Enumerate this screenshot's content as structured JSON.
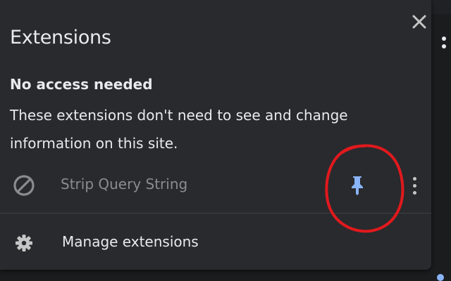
{
  "panel": {
    "title": "Extensions",
    "close_icon": "close-icon"
  },
  "section": {
    "heading": "No access needed",
    "description": "These extensions don't need to see and change information on this site."
  },
  "extensions": [
    {
      "name": "Strip Query String",
      "icon": "blocked-icon",
      "pin_icon": "pin-icon",
      "pinned": true,
      "more_icon": "more-vert-icon"
    }
  ],
  "footer": {
    "manage_label": "Manage extensions",
    "icon": "gear-icon"
  },
  "colors": {
    "panel_bg": "#292a2d",
    "text": "#e8eaed",
    "muted_text": "#8a8c90",
    "pin_accent": "#8ab4f8",
    "annotation": "#e0191d"
  }
}
